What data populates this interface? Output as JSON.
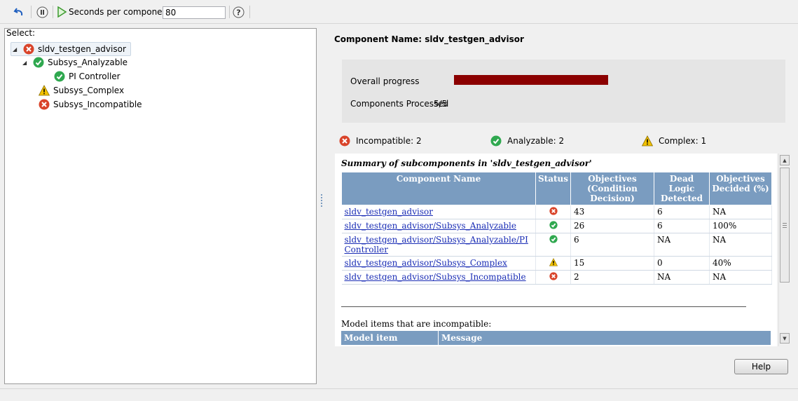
{
  "toolbar": {
    "undo_icon": "undo-icon",
    "pause_icon": "pause-icon",
    "run_icon": "play-icon",
    "seconds_label": "Seconds per component:",
    "seconds_value": "80",
    "help_icon": "question-icon"
  },
  "left_pane": {
    "select_label": "Select:",
    "tree": [
      {
        "label": "sldv_testgen_advisor",
        "status": "error",
        "expanded": true,
        "selected": true
      },
      {
        "label": "Subsys_Analyzable",
        "status": "ok",
        "expanded": true
      },
      {
        "label": "PI Controller",
        "status": "ok"
      },
      {
        "label": "Subsys_Complex",
        "status": "warning"
      },
      {
        "label": "Subsys_Incompatible",
        "status": "error"
      }
    ]
  },
  "main": {
    "component_name": "Component Name: sldv_testgen_advisor",
    "progress": {
      "overall_label": "Overall progress",
      "overall_fraction": 1.0,
      "processed_label": "Components Processed",
      "processed_value": "5/5"
    },
    "stats": {
      "incompatible": "Incompatible: 2",
      "analyzable": "Analyzable: 2",
      "complex": "Complex: 1"
    },
    "report": {
      "title": "Summary of subcomponents in 'sldv_testgen_advisor'",
      "headers": [
        "Component Name",
        "Status",
        "Objectives (Condition Decision)",
        "Dead Logic Detected",
        "Objectives Decided (%)"
      ],
      "rows": [
        {
          "name": "sldv_testgen_advisor",
          "status": "error",
          "objectives": "43",
          "dead_logic": "6",
          "decided": "NA"
        },
        {
          "name": "sldv_testgen_advisor/Subsys_Analyzable",
          "status": "ok",
          "objectives": "26",
          "dead_logic": "6",
          "decided": "100%"
        },
        {
          "name": "sldv_testgen_advisor/Subsys_Analyzable/PI Controller",
          "status": "ok",
          "objectives": "6",
          "dead_logic": "NA",
          "decided": "NA"
        },
        {
          "name": "sldv_testgen_advisor/Subsys_Complex",
          "status": "warning",
          "objectives": "15",
          "dead_logic": "0",
          "decided": "40%"
        },
        {
          "name": "sldv_testgen_advisor/Subsys_Incompatible",
          "status": "error",
          "objectives": "2",
          "dead_logic": "NA",
          "decided": "NA"
        }
      ],
      "incompatible_label": "Model items that are incompatible:",
      "items_headers": [
        "Model item",
        "Message"
      ]
    },
    "help_button": "Help"
  },
  "colors": {
    "error": "#d9442a",
    "ok": "#2fa84f",
    "warning": "#f2c200",
    "progress_fill": "#8b0000",
    "table_header": "#7a9cc0",
    "link": "#1a2db5"
  }
}
